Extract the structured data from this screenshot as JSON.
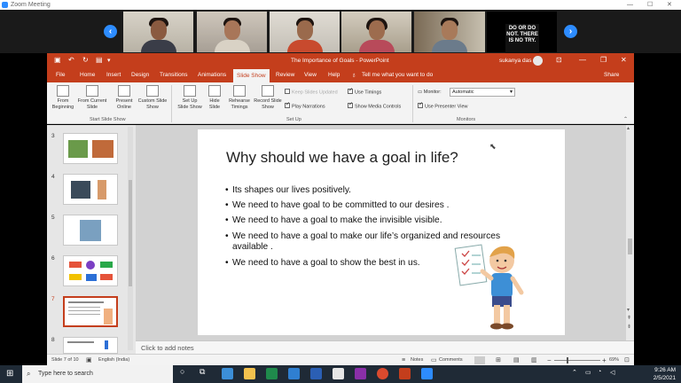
{
  "zoom": {
    "title": "Zoom Meeting"
  },
  "poster_text": "DO OR DO NOT. THERE IS NO TRY.",
  "ppt": {
    "title": "The Importance of Goals  -  PowerPoint",
    "user": "sukanya das",
    "share": "Share",
    "tell_me": "Tell me what you want to do",
    "tabs": [
      "File",
      "Home",
      "Insert",
      "Design",
      "Transitions",
      "Animations",
      "Slide Show",
      "Review",
      "View",
      "Help"
    ],
    "active_tab": "Slide Show"
  },
  "ribbon": {
    "from_beginning": "From Beginning",
    "from_current": "From Current Slide",
    "present_online": "Present Online",
    "custom_show": "Custom Slide Show",
    "group1": "Start Slide Show",
    "setup_show": "Set Up Slide Show",
    "hide_slide": "Hide Slide",
    "rehearse": "Rehearse Timings",
    "record": "Record Slide Show",
    "keep_updated": "Keep Slides Updated",
    "play_narrations": "Play Narrations",
    "use_timings": "Use Timings",
    "show_media": "Show Media Controls",
    "group2": "Set Up",
    "monitor_label": "Monitor:",
    "monitor_value": "Automatic",
    "presenter_view": "Use Presenter View",
    "group3": "Monitors"
  },
  "thumbs": [
    "3",
    "4",
    "5",
    "6",
    "7",
    "8"
  ],
  "slide": {
    "title": "Why should we have a goal in life?",
    "bullets": [
      "Its shapes our lives positively.",
      "We need to have goal to be committed to our desires .",
      "We need to have a goal to make the invisible visible.",
      "We need to have a goal to make our life’s organized and resources available .",
      "We need to have a goal to show the best in us."
    ]
  },
  "notes_placeholder": "Click to add notes",
  "status": {
    "slide_count": "Slide 7 of 10",
    "language": "English (India)",
    "notes": "Notes",
    "comments": "Comments",
    "zoom": "69%"
  },
  "taskbar": {
    "search_placeholder": "Type here to search",
    "time": "9:26 AM",
    "date": "2/5/2021"
  },
  "colors": {
    "ppt_accent": "#c43e1c",
    "zoom_blue": "#2d8cff"
  }
}
